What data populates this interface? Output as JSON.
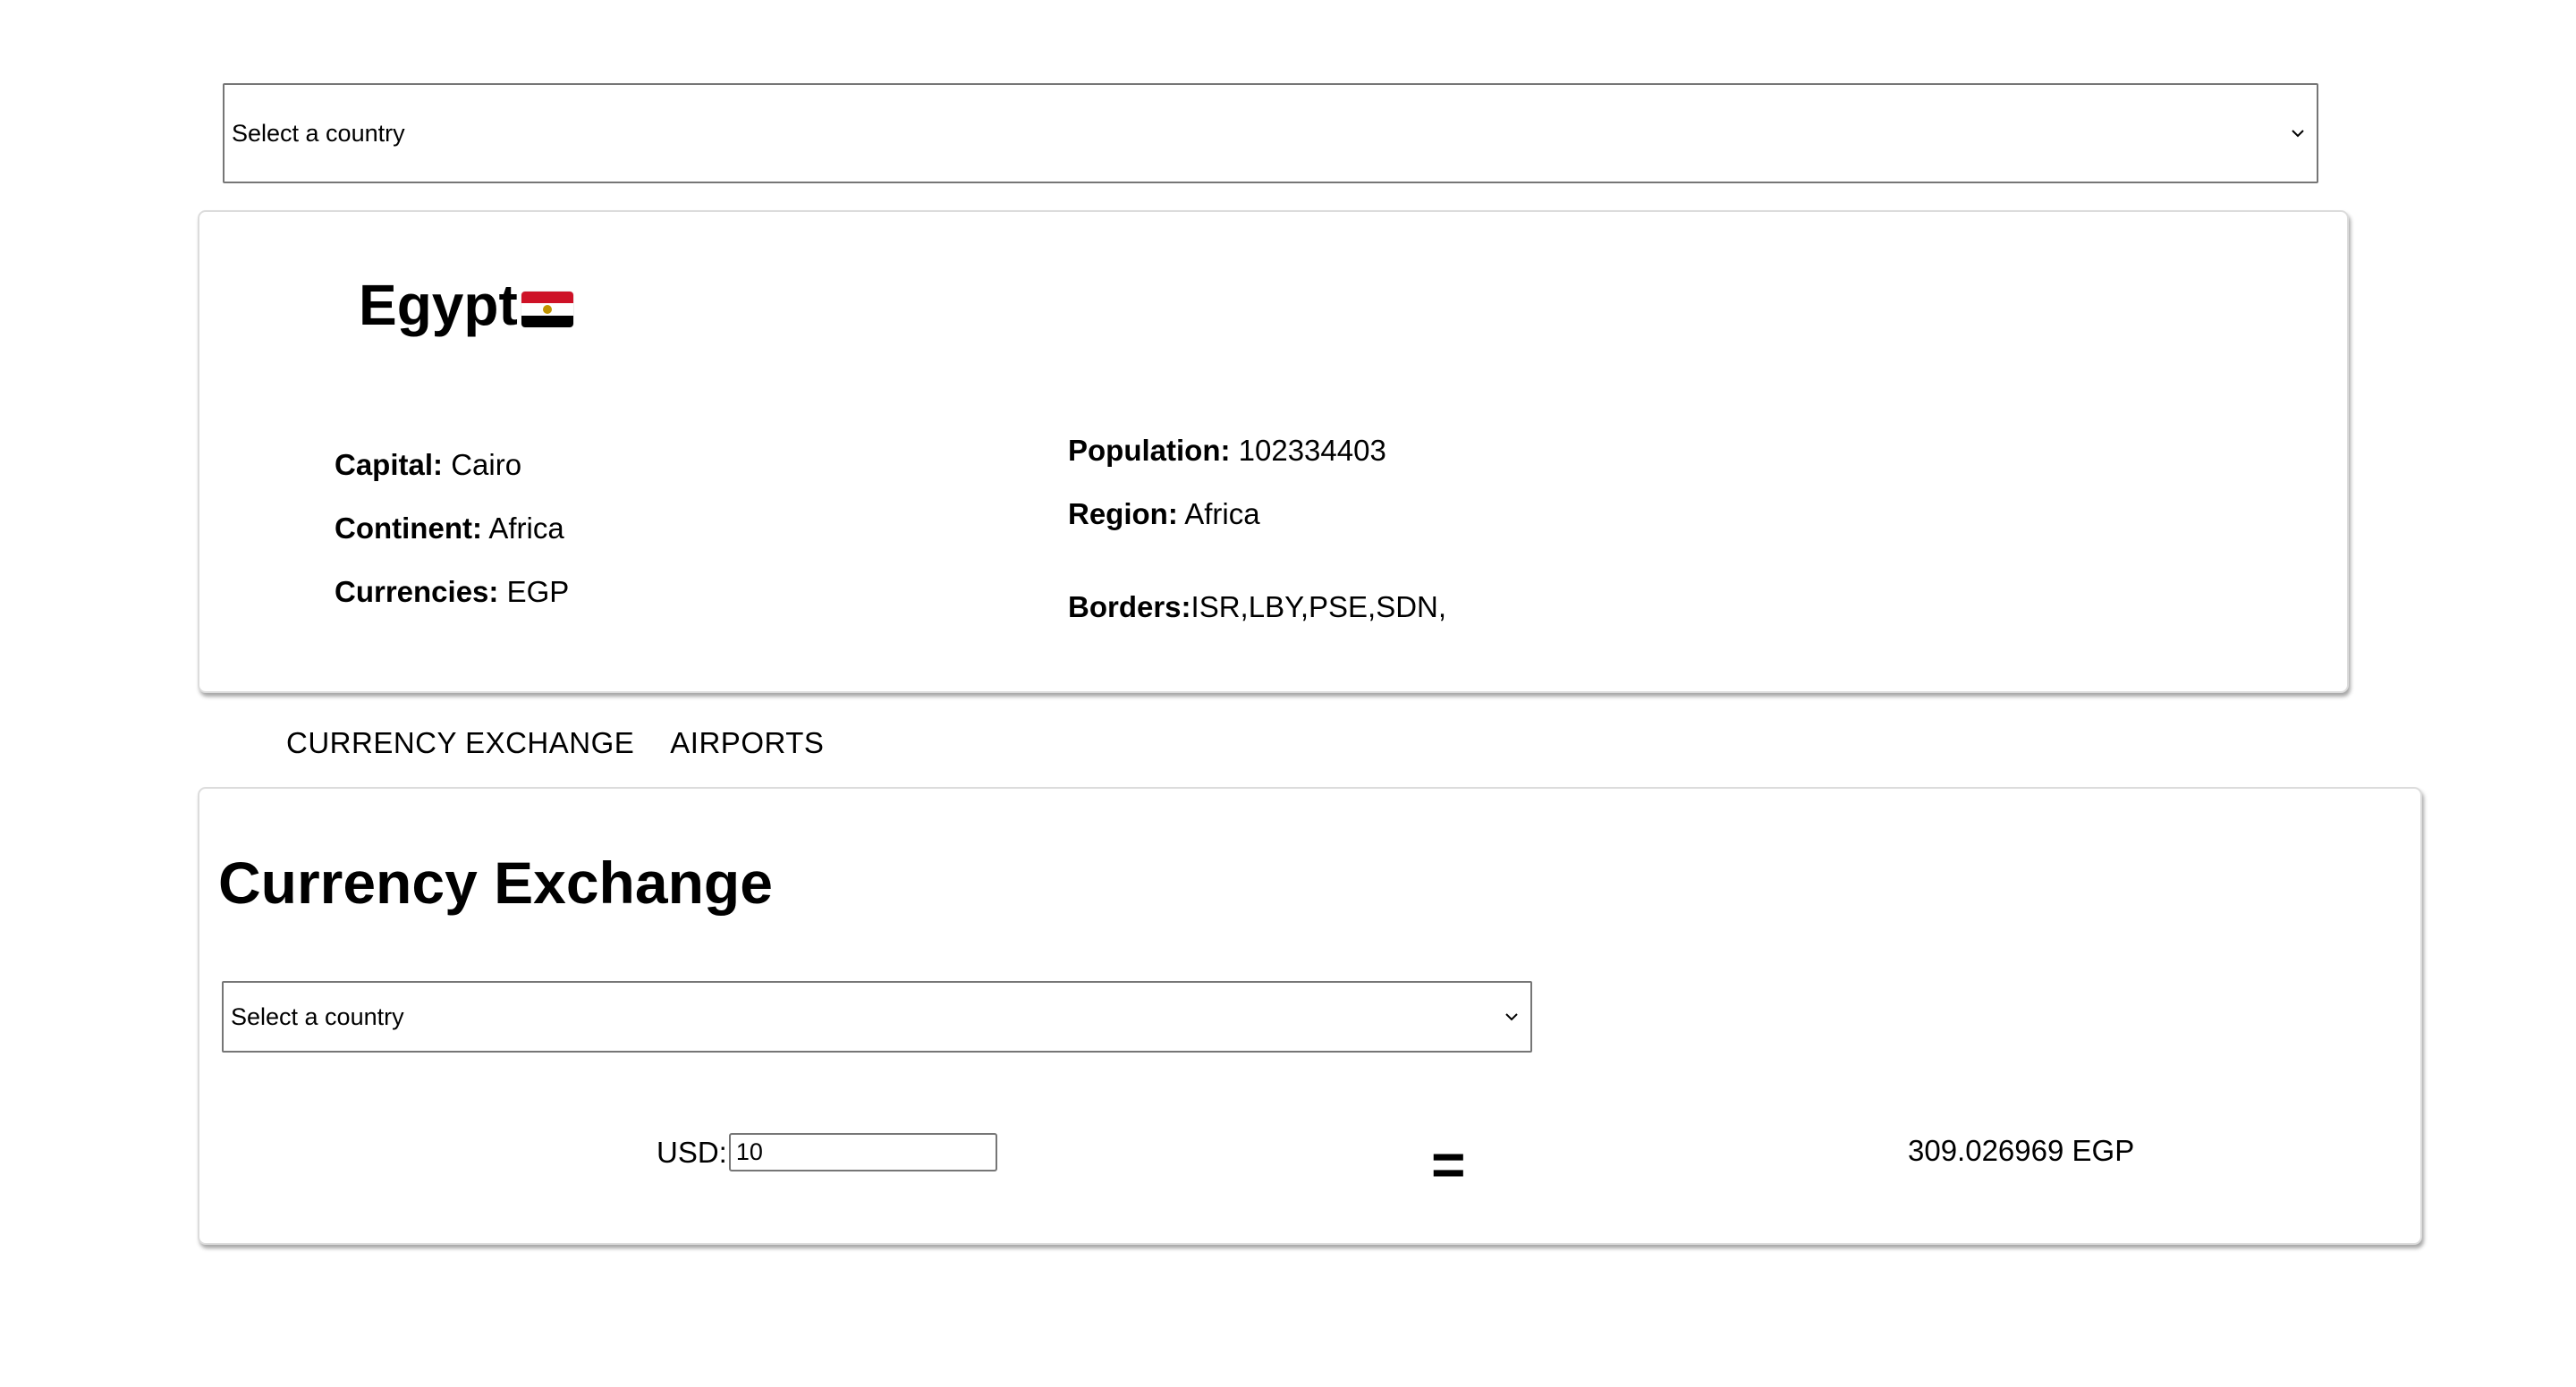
{
  "top_select": {
    "label": "Select a country"
  },
  "country": {
    "name": "Egypt",
    "flag_colors": [
      "#ce1126",
      "#ffffff",
      "#000000"
    ],
    "capital": {
      "label": "Capital:",
      "value": "Cairo"
    },
    "continent": {
      "label": "Continent:",
      "value": "Africa"
    },
    "currencies": {
      "label": "Currencies:",
      "value": "EGP"
    },
    "population": {
      "label": "Population:",
      "value": "102334403"
    },
    "region": {
      "label": "Region:",
      "value": "Africa"
    },
    "borders": {
      "label": "Borders:",
      "value": "ISR,LBY,PSE,SDN,"
    }
  },
  "tabs": [
    {
      "label": "CURRENCY EXCHANGE"
    },
    {
      "label": "AIRPORTS"
    }
  ],
  "exchange": {
    "title": "Currency Exchange",
    "select_label": "Select a country",
    "from_label": "USD:",
    "amount": "10",
    "equals": "=",
    "result": "309.026969 EGP"
  }
}
